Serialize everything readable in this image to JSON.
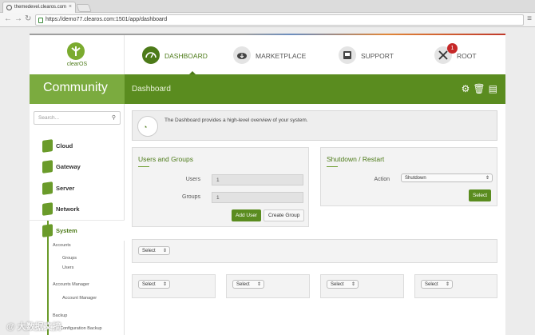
{
  "browser": {
    "tab_title": "themedevel.clearos.com",
    "url": "https://demo77.clearos.com:1501/app/dashboard"
  },
  "brand": {
    "logo_text": "clearOS"
  },
  "topnav": {
    "dashboard": "DASHBOARD",
    "marketplace": "MARKETPLACE",
    "support": "SUPPORT",
    "root": "ROOT",
    "root_badge": "1"
  },
  "header": {
    "edition": "Community",
    "breadcrumb": "Dashboard"
  },
  "sidebar": {
    "search_placeholder": "Search...",
    "items": [
      {
        "label": "Cloud"
      },
      {
        "label": "Gateway"
      },
      {
        "label": "Server"
      },
      {
        "label": "Network"
      },
      {
        "label": "System"
      }
    ],
    "system_sub": {
      "accounts": "Accounts",
      "groups": "Groups",
      "users": "Users",
      "accounts_manager": "Accounts Manager",
      "account_manager": "Account Manager",
      "backup": "Backup",
      "configuration_backup": "Configuration Backup"
    }
  },
  "info": {
    "text": "The Dashboard provides a high-level overview of your system."
  },
  "users_groups": {
    "title": "Users and Groups",
    "users_label": "Users",
    "users_value": "1",
    "groups_label": "Groups",
    "groups_value": "1",
    "add_user": "Add User",
    "create_group": "Create Group"
  },
  "shutdown": {
    "title": "Shutdown / Restart",
    "action_label": "Action",
    "action_value": "Shutdown",
    "select_button": "Select"
  },
  "widgets": {
    "select_label": "Select"
  },
  "watermark": "大数据文摘"
}
